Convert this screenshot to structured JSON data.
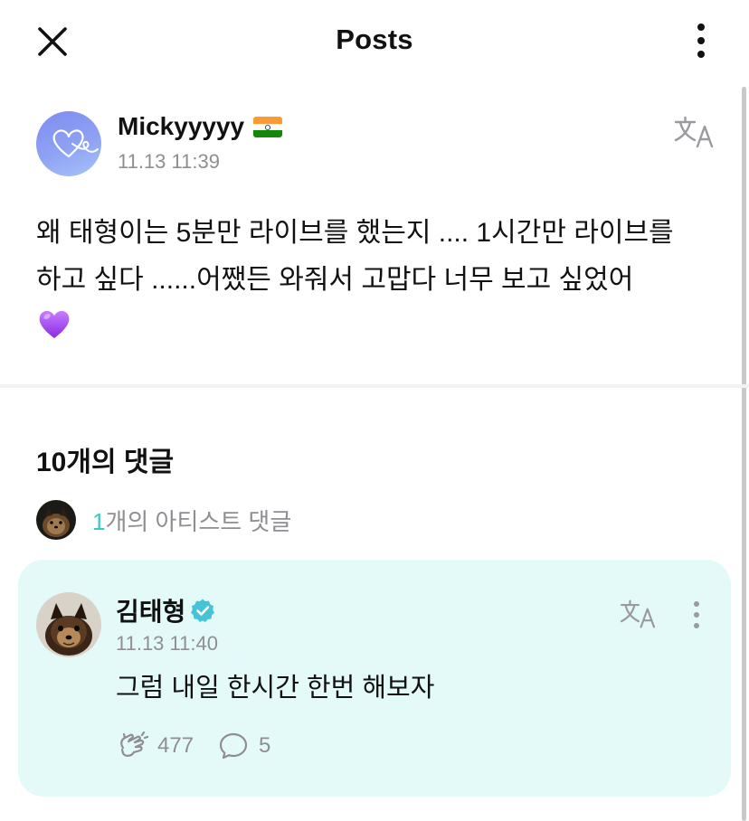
{
  "header": {
    "title": "Posts",
    "close_icon": "close-icon",
    "more_icon": "more-vertical-icon"
  },
  "post": {
    "author": "Mickyyyyy",
    "flag": "india-flag",
    "timestamp": "11.13 11:39",
    "body": "왜 태형이는 5분만 라이브를 했는지 .... 1시간만 라이브를 하고 싶다 ......어쨌든 와줘서 고맙다 너무 보고 싶었어",
    "emoji": "purple-heart",
    "translate_icon": "translate-icon"
  },
  "comments": {
    "count_label": "10개의 댓글",
    "artist_count": "1",
    "artist_label": "개의 아티스트 댓글"
  },
  "artist_comment": {
    "author": "김태형",
    "verified": true,
    "timestamp": "11.13 11:40",
    "text": "그럼 내일 한시간 한번 해보자",
    "likes": "477",
    "replies": "5"
  },
  "colors": {
    "accent": "#3ec7c0",
    "card_bg": "#e4faf8",
    "muted_text": "#8e8e93",
    "verified": "#45c4d8"
  }
}
